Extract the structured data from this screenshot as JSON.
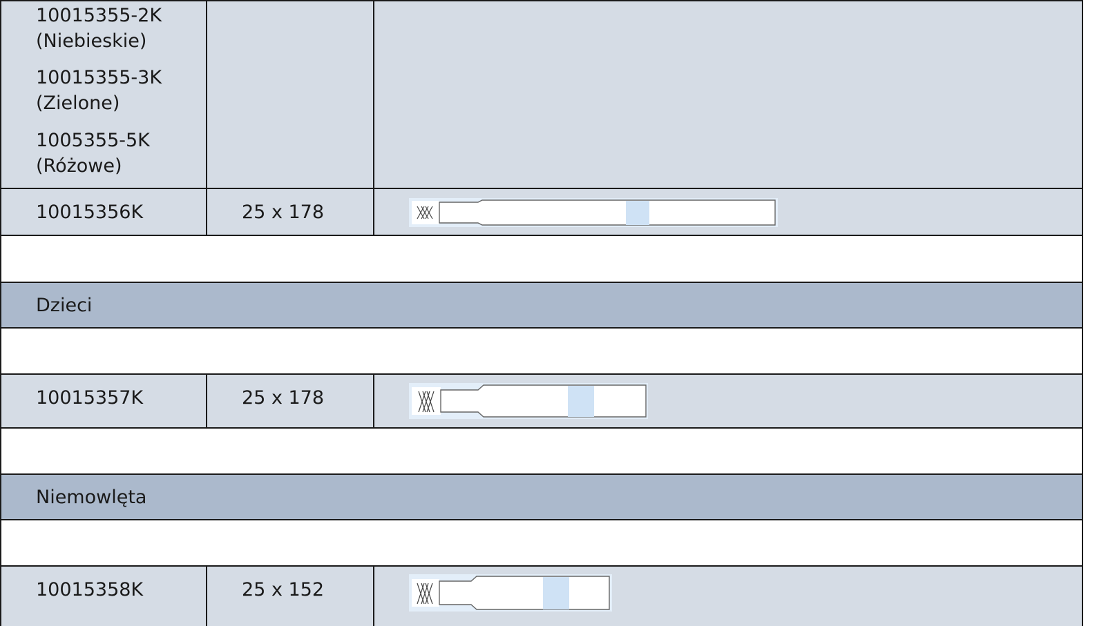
{
  "top_row": {
    "codes": [
      {
        "code": "10015355-2K",
        "color": "(Niebieskie)"
      },
      {
        "code": "10015355-3K",
        "color": "(Zielone)"
      },
      {
        "code": "1005355-5K",
        "color": "(Różowe)"
      }
    ]
  },
  "row_adult": {
    "code": "10015356K",
    "size": "25 x 178"
  },
  "section_children": {
    "title": "Dzieci"
  },
  "row_children": {
    "code": "10015357K",
    "size": "25 x 178"
  },
  "section_infants": {
    "title": "Niemowlęta"
  },
  "row_infants": {
    "code": "10015358K",
    "size": "25 x 152"
  },
  "colors": {
    "data_row_bg": "#d5dce5",
    "section_bg": "#abb9cc",
    "band_highlight": "#cfe2f5",
    "grid_line": "#1a1a1a"
  }
}
